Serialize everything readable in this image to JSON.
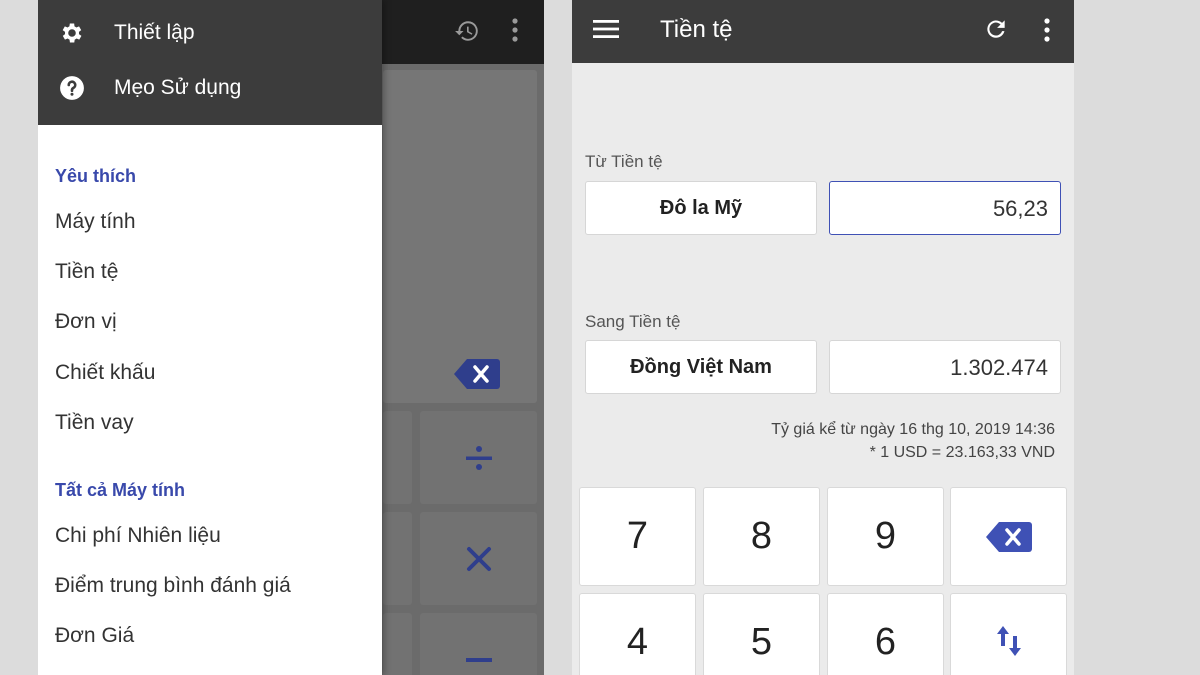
{
  "left_screen": {
    "drawer": {
      "header_items": [
        {
          "icon": "gear-icon",
          "label": "Thiết lập"
        },
        {
          "icon": "help-icon",
          "label": "Mẹo Sử dụng"
        }
      ],
      "favorites_title": "Yêu thích",
      "favorites": [
        "Máy tính",
        "Tiền tệ",
        "Đơn vị",
        "Chiết khấu",
        "Tiền vay"
      ],
      "all_title": "Tất cả Máy tính",
      "all_items": [
        "Chi phí Nhiên liệu",
        "Điểm trung bình đánh giá",
        "Đơn Giá"
      ]
    },
    "operators": [
      "÷",
      "×",
      "−"
    ]
  },
  "right_screen": {
    "title": "Tiền tệ",
    "from": {
      "label": "Từ Tiền tệ",
      "currency": "Đô la Mỹ",
      "amount": "56,23"
    },
    "to": {
      "label": "Sang Tiền tệ",
      "currency": "Đồng Việt Nam",
      "amount": "1.302.474"
    },
    "rate_date": "Tỷ giá kể từ ngày 16 thg 10, 2019 14:36",
    "rate_value": "* 1 USD = 23.163,33 VND",
    "keypad_row1": [
      "7",
      "8",
      "9"
    ],
    "keypad_row2": [
      "4",
      "5",
      "6"
    ]
  },
  "colors": {
    "accent": "#3f51b5",
    "appbar": "#3c3c3c",
    "left_appbar": "#1f1f1f"
  }
}
